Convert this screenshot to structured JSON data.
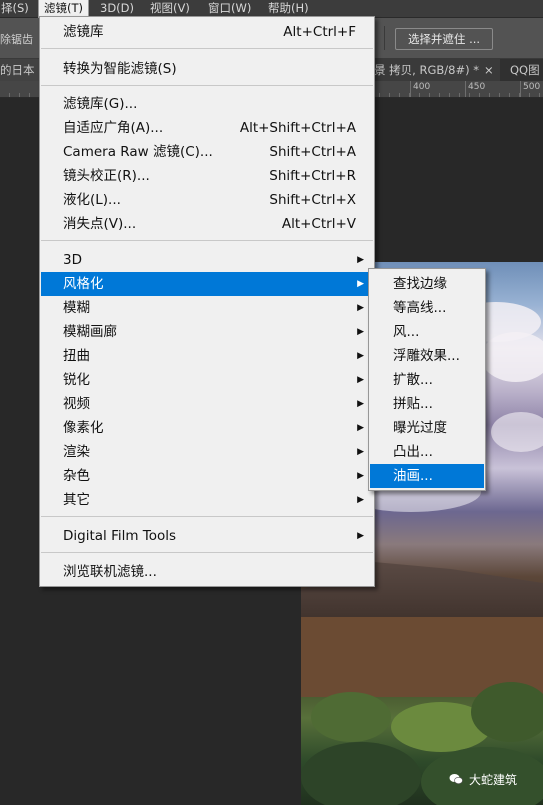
{
  "menubar": {
    "items": [
      {
        "label": "择(S)"
      },
      {
        "label": "滤镜(T)"
      },
      {
        "label": "3D(D)"
      },
      {
        "label": "视图(V)"
      },
      {
        "label": "窗口(W)"
      },
      {
        "label": "帮助(H)"
      }
    ]
  },
  "options_bar": {
    "antialias_label": "除锯齿",
    "select_mask_label": "选择并遮住 ..."
  },
  "doc_tabs": {
    "left_tab": "的日本",
    "doc_tab": "景 拷贝, RGB/8#) *",
    "close_glyph": "×",
    "qq_tab": "QQ图"
  },
  "ruler": {
    "labels": [
      "400",
      "450",
      "500"
    ]
  },
  "filter_menu": {
    "items": [
      {
        "label": "滤镜库",
        "shortcut": "Alt+Ctrl+F"
      },
      {
        "label": "转换为智能滤镜(S)",
        "shortcut": ""
      },
      {
        "label": "滤镜库(G)...",
        "shortcut": ""
      },
      {
        "label": "自适应广角(A)...",
        "shortcut": "Alt+Shift+Ctrl+A"
      },
      {
        "label": "Camera Raw 滤镜(C)...",
        "shortcut": "Shift+Ctrl+A"
      },
      {
        "label": "镜头校正(R)...",
        "shortcut": "Shift+Ctrl+R"
      },
      {
        "label": "液化(L)...",
        "shortcut": "Shift+Ctrl+X"
      },
      {
        "label": "消失点(V)...",
        "shortcut": "Alt+Ctrl+V"
      },
      {
        "label": "3D",
        "submenu": true
      },
      {
        "label": "风格化",
        "submenu": true,
        "highlighted": true
      },
      {
        "label": "模糊",
        "submenu": true
      },
      {
        "label": "模糊画廊",
        "submenu": true
      },
      {
        "label": "扭曲",
        "submenu": true
      },
      {
        "label": "锐化",
        "submenu": true
      },
      {
        "label": "视频",
        "submenu": true
      },
      {
        "label": "像素化",
        "submenu": true
      },
      {
        "label": "渲染",
        "submenu": true
      },
      {
        "label": "杂色",
        "submenu": true
      },
      {
        "label": "其它",
        "submenu": true
      },
      {
        "label": "Digital Film Tools",
        "submenu": true
      },
      {
        "label": "浏览联机滤镜...",
        "shortcut": ""
      }
    ]
  },
  "stylize_menu": {
    "items": [
      {
        "label": "查找边缘"
      },
      {
        "label": "等高线..."
      },
      {
        "label": "风..."
      },
      {
        "label": "浮雕效果..."
      },
      {
        "label": "扩散..."
      },
      {
        "label": "拼贴..."
      },
      {
        "label": "曝光过度"
      },
      {
        "label": "凸出..."
      },
      {
        "label": "油画...",
        "highlighted": true
      }
    ]
  },
  "submenu_arrow": "▶",
  "watermark": {
    "text": "大蛇建筑",
    "icon": "wechat-icon"
  },
  "colors": {
    "highlight": "#0078d7",
    "menu_bg": "#f0f0f0",
    "app_bg": "#282828"
  }
}
